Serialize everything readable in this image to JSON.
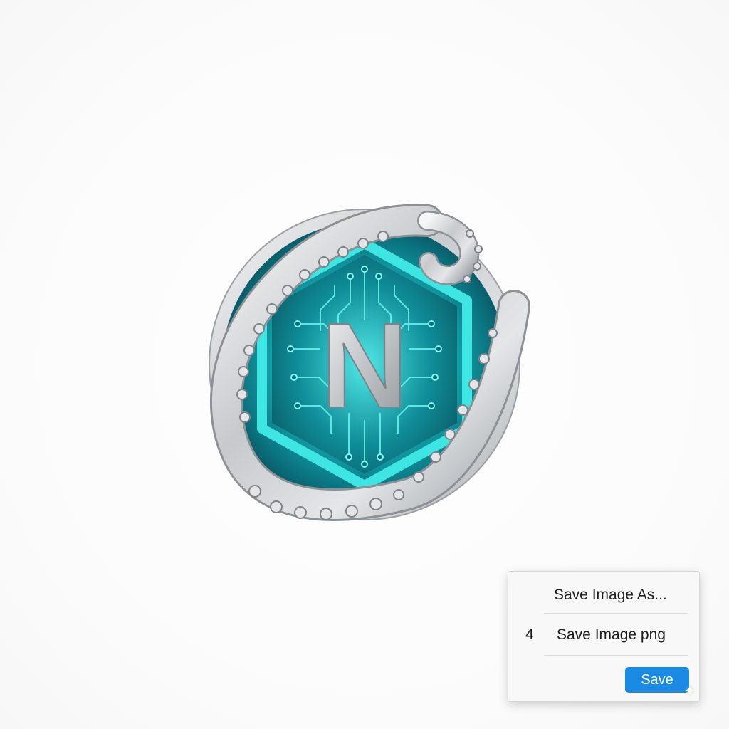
{
  "logo": {
    "letter": "N",
    "accent_color": "#1fd6d6",
    "dark_color": "#0a5f6a",
    "metal_color": "#c9ccd0"
  },
  "context_menu": {
    "items": [
      {
        "number": "",
        "label": "Save Image As..."
      },
      {
        "number": "4",
        "label": "Save Image png"
      }
    ],
    "save_button_label": "Save",
    "button_color": "#1a8ae5"
  },
  "overlay": {
    "icon": "sparkle-icon"
  }
}
